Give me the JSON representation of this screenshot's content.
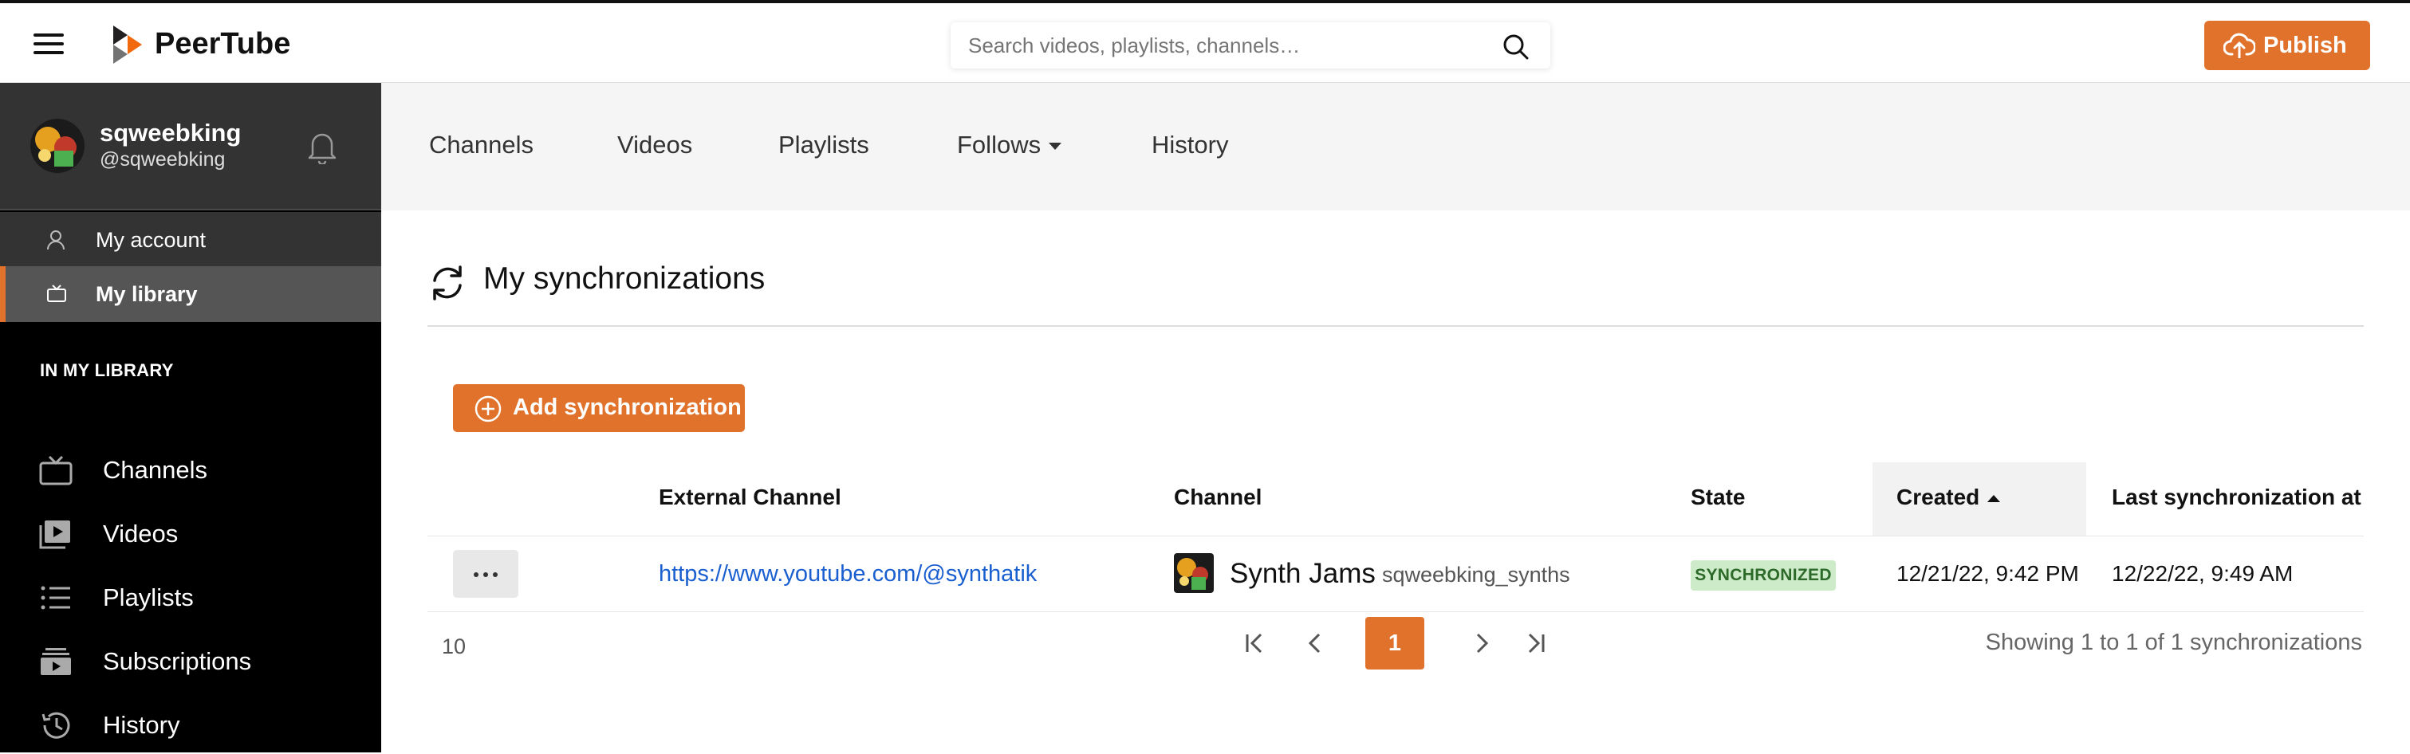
{
  "topbar": {
    "brand": "PeerTube",
    "search_placeholder": "Search videos, playlists, channels…",
    "publish_label": "Publish"
  },
  "sidebar": {
    "user": {
      "name": "sqweebking",
      "handle": "@sqweebking"
    },
    "nav": {
      "account": "My account",
      "library": "My library"
    },
    "library_heading": "IN MY LIBRARY",
    "library_items": [
      {
        "label": "Channels",
        "icon": "tv-icon"
      },
      {
        "label": "Videos",
        "icon": "video-library-icon"
      },
      {
        "label": "Playlists",
        "icon": "list-icon"
      },
      {
        "label": "Subscriptions",
        "icon": "subscriptions-icon"
      },
      {
        "label": "History",
        "icon": "history-icon"
      }
    ]
  },
  "subnav": {
    "tabs": [
      "Channels",
      "Videos",
      "Playlists",
      "Follows",
      "History"
    ]
  },
  "page": {
    "title": "My synchronizations",
    "add_button": "Add synchronization"
  },
  "table": {
    "headers": {
      "external_channel": "External Channel",
      "channel": "Channel",
      "state": "State",
      "created": "Created",
      "last_sync": "Last synchronization at"
    },
    "rows": [
      {
        "external_channel": "https://www.youtube.com/@synthatik",
        "channel_name": "Synth Jams",
        "channel_handle": "sqweebking_synths",
        "state": "SYNCHRONIZED",
        "created": "12/21/22, 9:42 PM",
        "last_sync": "12/22/22, 9:49 AM"
      }
    ]
  },
  "pagination": {
    "per_page": "10",
    "current_page": "1",
    "summary": "Showing 1 to 1 of 1 synchronizations"
  },
  "colors": {
    "accent": "#e0722b",
    "link": "#1a5fd0",
    "badge_bg": "#cdebc9",
    "badge_text": "#2d6a2a",
    "sidebar_bg": "#000000"
  }
}
